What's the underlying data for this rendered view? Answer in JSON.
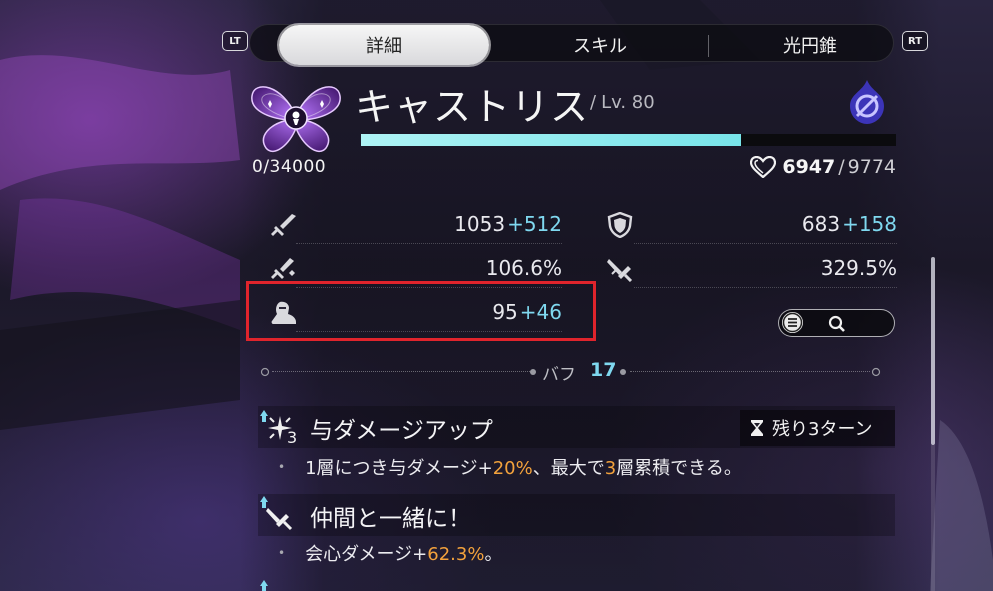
{
  "tabs": {
    "left_button": "LT",
    "right_button": "RT",
    "items": [
      "詳細",
      "スキル",
      "光円錐"
    ],
    "active_index": 0
  },
  "character": {
    "name": "キャストリス",
    "level_prefix": "/",
    "level": "Lv. 80",
    "exp": "0/34000",
    "hp_current": "6947",
    "hp_separator": "/",
    "hp_max": "9774",
    "hp_fraction": 0.711,
    "path_icon": "remembrance-path-icon",
    "element_icon": "quantum-element-icon"
  },
  "stats": {
    "atk": {
      "icon": "sword-icon",
      "base": "1053",
      "bonus": "+512"
    },
    "def": {
      "icon": "shield-icon",
      "base": "683",
      "bonus": "+158"
    },
    "crit_rate": {
      "icon": "crit-rate-icon",
      "value": "106.6%"
    },
    "crit_dmg": {
      "icon": "crit-dmg-icon",
      "value": "329.5%"
    },
    "spd": {
      "icon": "boot-icon",
      "base": "95",
      "bonus": "+46"
    }
  },
  "buffs": {
    "header_label": "バフ",
    "count": "17",
    "items": [
      {
        "title": "与ダメージアップ",
        "stack": "3",
        "turns": "残り3ターン",
        "desc_parts": [
          "1層につき与ダメージ+",
          "20%",
          "、最大で",
          "3",
          "層累積できる。"
        ]
      },
      {
        "title": "仲間と一緒に！",
        "desc_parts": [
          "会心ダメージ+",
          "62.3%",
          "。"
        ]
      }
    ]
  },
  "colors": {
    "accent_cyan": "#7fd8ef",
    "highlight_orange": "#f3a23c",
    "hp_bar": "#9ff0f2",
    "highlight_box": "#e0242c"
  }
}
